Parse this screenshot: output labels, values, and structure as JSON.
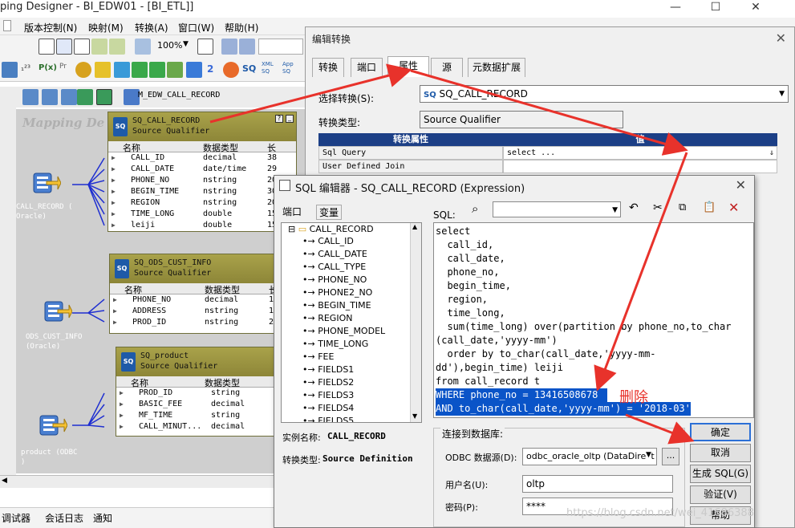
{
  "main_window": {
    "title": "ping Designer - BI_EDW01 - [BI_ETL]]",
    "menu": [
      "版本控制(N)",
      "映射(M)",
      "转换(A)",
      "窗口(W)",
      "帮助(H)"
    ],
    "zoom": "100%",
    "mapping_name": "M_EDW_CALL_RECORD",
    "watermark_text": "Mapping De",
    "status_tabs": [
      "调试器",
      "会话日志",
      "通知"
    ]
  },
  "sources": [
    {
      "label": "CALL_RECORD (\nOracle)"
    },
    {
      "label": "ODS_CUST_INFO\n(Oracle)"
    },
    {
      "label": "product (ODBC\n)"
    }
  ],
  "qualifiers": [
    {
      "name": "SQ_CALL_RECORD",
      "type": "Source Qualifier",
      "columns": [
        "名称",
        "数据类型",
        "长"
      ],
      "rows": [
        {
          "name": "CALL_ID",
          "type": "decimal",
          "len": "38"
        },
        {
          "name": "CALL_DATE",
          "type": "date/time",
          "len": "29"
        },
        {
          "name": "PHONE_NO",
          "type": "nstring",
          "len": "20"
        },
        {
          "name": "BEGIN_TIME",
          "type": "nstring",
          "len": "30"
        },
        {
          "name": "REGION",
          "type": "nstring",
          "len": "20"
        },
        {
          "name": "TIME_LONG",
          "type": "double",
          "len": "15"
        },
        {
          "name": "leiji",
          "type": "double",
          "len": "15"
        }
      ]
    },
    {
      "name": "SQ_ODS_CUST_INFO",
      "type": "Source Qualifier",
      "columns": [
        "名称",
        "数据类型",
        "长"
      ],
      "rows": [
        {
          "name": "PHONE_NO",
          "type": "decimal",
          "len": "1"
        },
        {
          "name": "ADDRESS",
          "type": "nstring",
          "len": "1"
        },
        {
          "name": "PROD_ID",
          "type": "nstring",
          "len": "2"
        }
      ]
    },
    {
      "name": "SQ_product",
      "type": "Source Qualifier",
      "columns": [
        "名称",
        "数据类型",
        ""
      ],
      "rows": [
        {
          "name": "PROD_ID",
          "type": "string",
          "len": ""
        },
        {
          "name": "BASIC_FEE",
          "type": "decimal",
          "len": ""
        },
        {
          "name": "MF_TIME",
          "type": "string",
          "len": ""
        },
        {
          "name": "CALL_MINUT...",
          "type": "decimal",
          "len": ""
        }
      ]
    }
  ],
  "edit_dialog": {
    "title": "编辑转换",
    "tabs": [
      "转换",
      "端口",
      "属性",
      "源",
      "元数据扩展"
    ],
    "select_label": "选择转换(S):",
    "select_value": "SQ_CALL_RECORD",
    "type_label": "转换类型:",
    "type_value": "Source Qualifier",
    "prop_header": "转换属性",
    "prop_header2": "值",
    "props": [
      {
        "name": "Sql Query",
        "value": "select ..."
      },
      {
        "name": "User Defined Join",
        "value": ""
      }
    ]
  },
  "sql_dialog": {
    "title": "SQL 编辑器 - SQ_CALL_RECORD (Expression)",
    "tab_ports": "端口",
    "tab_vars": "变量",
    "sql_label": "SQL:",
    "tree_root": "CALL_RECORD",
    "tree_items": [
      "CALL_ID",
      "CALL_DATE",
      "CALL_TYPE",
      "PHONE_NO",
      "PHONE2_NO",
      "BEGIN_TIME",
      "REGION",
      "PHONE_MODEL",
      "TIME_LONG",
      "FEE",
      "FIELDS1",
      "FIELDS2",
      "FIELDS3",
      "FIELDS4",
      "FIELDS5"
    ],
    "sql_lines": [
      "select",
      "  call_id,",
      "  call_date,",
      "  phone_no,",
      "  begin_time,",
      "  region,",
      "  time_long,",
      "  sum(time_long) over(partition by phone_no,to_char",
      "(call_date,'yyyy-mm')",
      "  order by to_char(call_date,'yyyy-mm-",
      "dd'),begin_time) leiji",
      "from call_record t",
      "WHERE phone_no = 13416508678",
      "AND to_char(call_date,'yyyy-mm') = '2018-03'"
    ],
    "instance_label": "实例名称:",
    "instance_value": "CALL_RECORD",
    "conv_label": "转换类型:",
    "conv_value": "Source Definition",
    "db_group": "连接到数据库:",
    "odbc_label": "ODBC 数据源(D):",
    "odbc_value": "odbc_oracle_oltp (DataDirect 6",
    "user_label": "用户名(U):",
    "user_value": "oltp",
    "pwd_label": "密码(P):",
    "pwd_value": "****",
    "buttons": [
      "确定",
      "取消",
      "生成 SQL(G)",
      "验证(V)",
      "帮助"
    ]
  },
  "annotation": "删除",
  "blog_watermark": "https://blog.csdn.net/wei_41686388",
  "colors": {
    "arrow": "#e8322b",
    "highlight": "#0a54c8",
    "header": "#1c3f86",
    "qualifier": "#a9a24a"
  }
}
